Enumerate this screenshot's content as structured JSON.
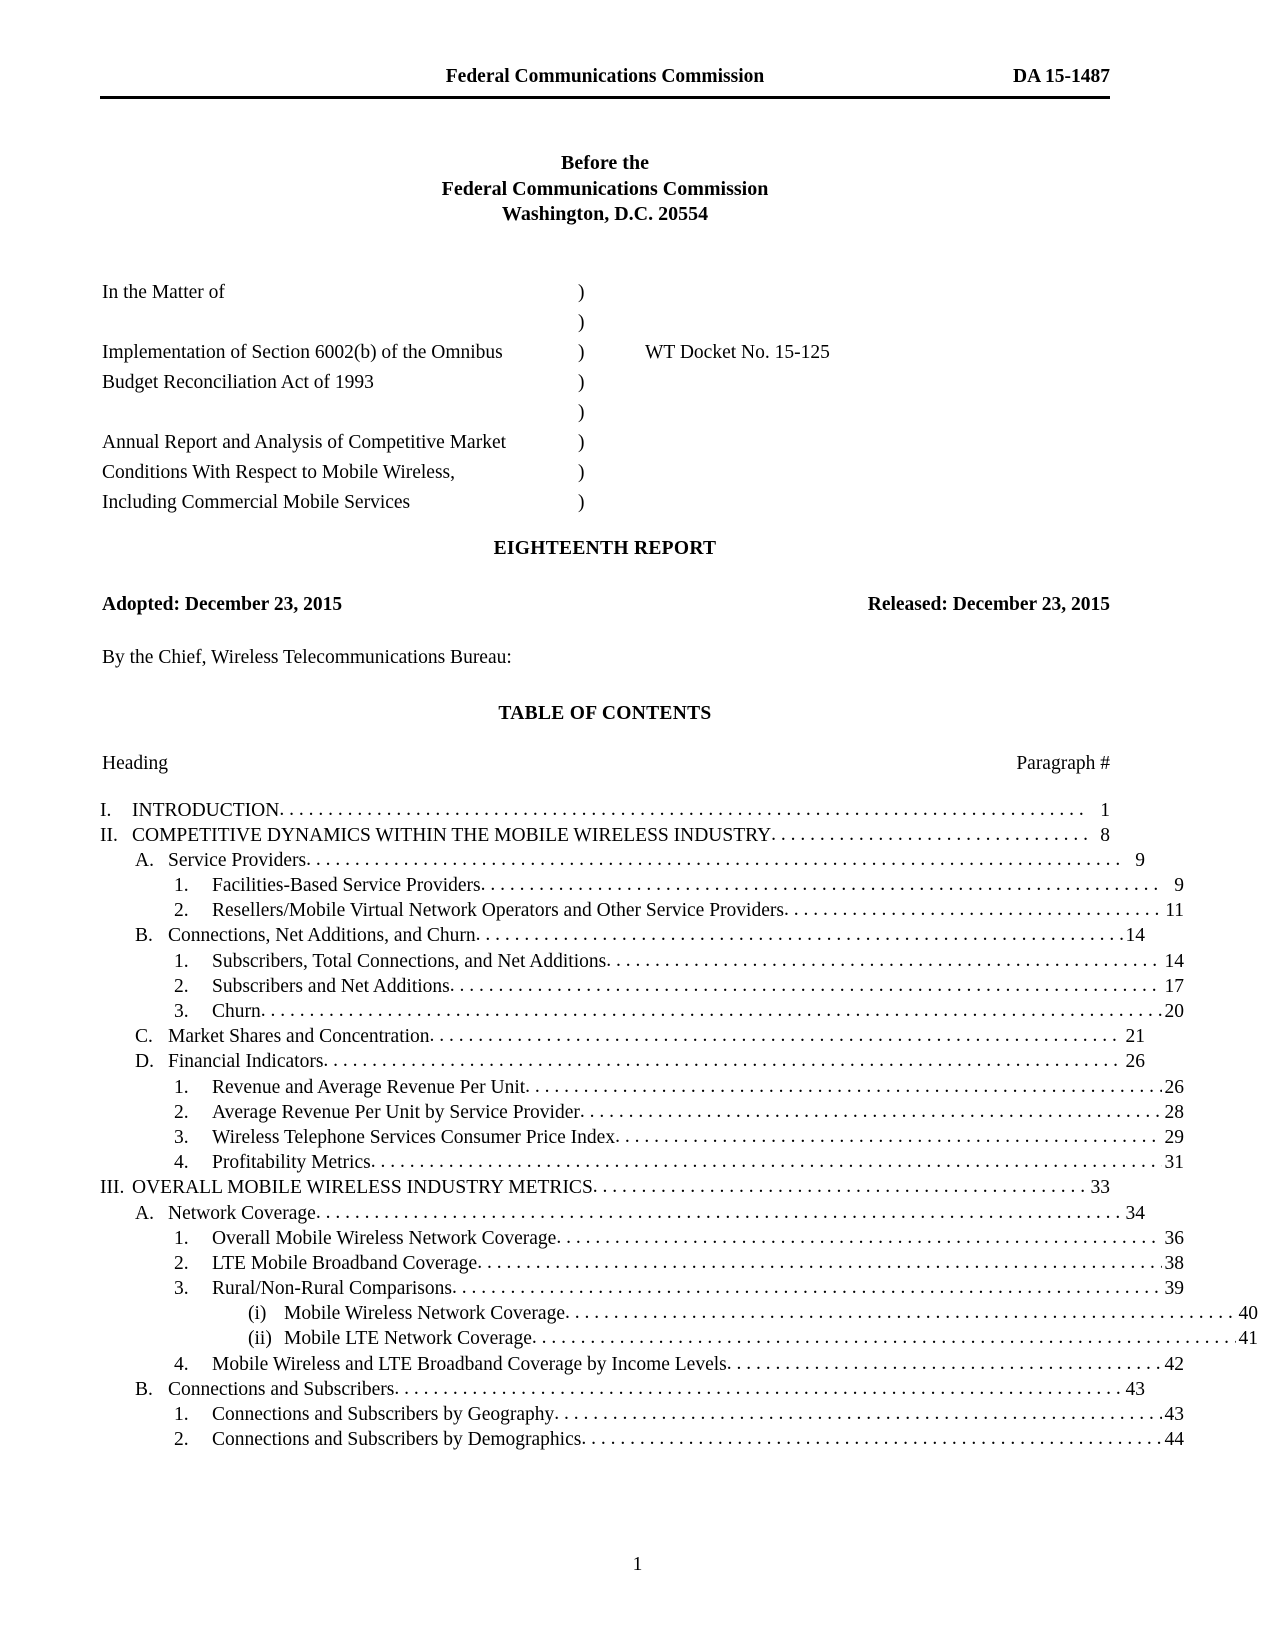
{
  "running_header": {
    "title": "Federal Communications Commission",
    "doc_number": "DA 15-1487"
  },
  "title_block": {
    "line1": "Before the",
    "line2": "Federal Communications Commission",
    "line3": "Washington, D.C. 20554"
  },
  "caption": {
    "left_lines": [
      "In the Matter of",
      "",
      "Implementation of Section 6002(b) of the Omnibus",
      "Budget Reconciliation Act of 1993",
      "",
      "Annual Report and Analysis of Competitive Market",
      "Conditions With Respect to Mobile Wireless,",
      "Including Commercial Mobile Services"
    ],
    "paren": ")",
    "paren_count": 8,
    "docket": "WT Docket No. 15-125"
  },
  "report_title": "EIGHTEENTH REPORT",
  "dates": {
    "adopted": "Adopted:  December 23, 2015",
    "released": "Released:  December 23, 2015"
  },
  "byline": "By the Chief, Wireless Telecommunications Bureau:",
  "toc_title": "TABLE OF CONTENTS",
  "toc_columns": {
    "heading": "Heading",
    "paragraph": "Paragraph #"
  },
  "toc_entries": [
    {
      "level": 1,
      "num": "I.",
      "text": "INTRODUCTION",
      "page": "1"
    },
    {
      "level": 1,
      "num": "II.",
      "text": "COMPETITIVE DYNAMICS WITHIN THE MOBILE WIRELESS INDUSTRY",
      "page": "8"
    },
    {
      "level": 2,
      "num": "A.",
      "text": "Service Providers",
      "page": "9"
    },
    {
      "level": 3,
      "num": "1.",
      "text": "Facilities-Based Service Providers",
      "page": "9"
    },
    {
      "level": 3,
      "num": "2.",
      "text": "Resellers/Mobile Virtual Network Operators and Other Service Providers",
      "page": "11"
    },
    {
      "level": 2,
      "num": "B.",
      "text": "Connections, Net Additions, and Churn",
      "page": "14"
    },
    {
      "level": 3,
      "num": "1.",
      "text": "Subscribers, Total Connections, and Net Additions",
      "page": "14"
    },
    {
      "level": 3,
      "num": "2.",
      "text": "Subscribers and Net Additions",
      "page": "17"
    },
    {
      "level": 3,
      "num": "3.",
      "text": "Churn",
      "page": "20"
    },
    {
      "level": 2,
      "num": "C.",
      "text": "Market Shares and Concentration",
      "page": "21"
    },
    {
      "level": 2,
      "num": "D.",
      "text": "Financial Indicators",
      "page": "26"
    },
    {
      "level": 3,
      "num": "1.",
      "text": "Revenue and Average Revenue Per Unit",
      "page": "26"
    },
    {
      "level": 3,
      "num": "2.",
      "text": "Average Revenue Per Unit by Service Provider",
      "page": "28"
    },
    {
      "level": 3,
      "num": "3.",
      "text": "Wireless Telephone Services Consumer Price Index",
      "page": "29"
    },
    {
      "level": 3,
      "num": "4.",
      "text": "Profitability Metrics",
      "page": "31"
    },
    {
      "level": 1,
      "num": "III.",
      "text": "OVERALL MOBILE WIRELESS INDUSTRY METRICS",
      "page": "33"
    },
    {
      "level": 2,
      "num": "A.",
      "text": "Network Coverage",
      "page": "34"
    },
    {
      "level": 3,
      "num": "1.",
      "text": "Overall Mobile Wireless Network Coverage",
      "page": "36"
    },
    {
      "level": 3,
      "num": "2.",
      "text": "LTE Mobile Broadband Coverage",
      "page": "38"
    },
    {
      "level": 3,
      "num": "3.",
      "text": "Rural/Non-Rural Comparisons",
      "page": "39"
    },
    {
      "level": 4,
      "num": "(i)",
      "text": "Mobile Wireless Network Coverage",
      "page": "40"
    },
    {
      "level": 4,
      "num": "(ii)",
      "text": "Mobile LTE Network Coverage",
      "page": "41"
    },
    {
      "level": 3,
      "num": "4.",
      "text": "Mobile Wireless and LTE Broadband Coverage by Income Levels",
      "page": "42"
    },
    {
      "level": 2,
      "num": "B.",
      "text": "Connections and Subscribers",
      "page": "43"
    },
    {
      "level": 3,
      "num": "1.",
      "text": "Connections and Subscribers by Geography",
      "page": "43"
    },
    {
      "level": 3,
      "num": "2.",
      "text": "Connections and Subscribers by Demographics",
      "page": "44"
    }
  ],
  "footer_page_number": "1"
}
